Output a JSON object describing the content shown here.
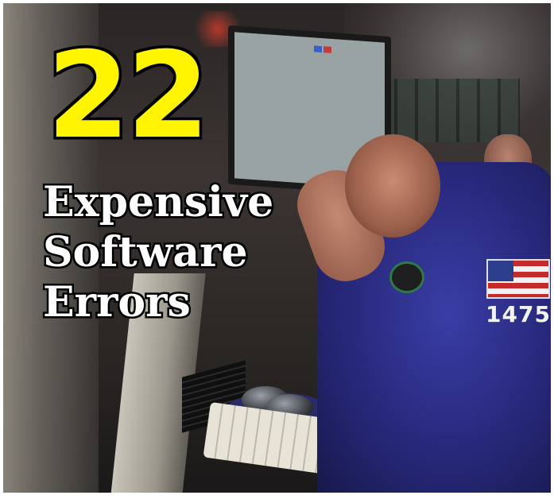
{
  "headline": {
    "number": "22",
    "line1": "Expensive",
    "line2": "Software",
    "line3": "Errors"
  },
  "scene": {
    "badge_number": "1475"
  },
  "colors": {
    "number_fill": "#fff500",
    "text_fill": "#ffffff",
    "outline": "#000000",
    "jacket": "#2c2e8a"
  }
}
